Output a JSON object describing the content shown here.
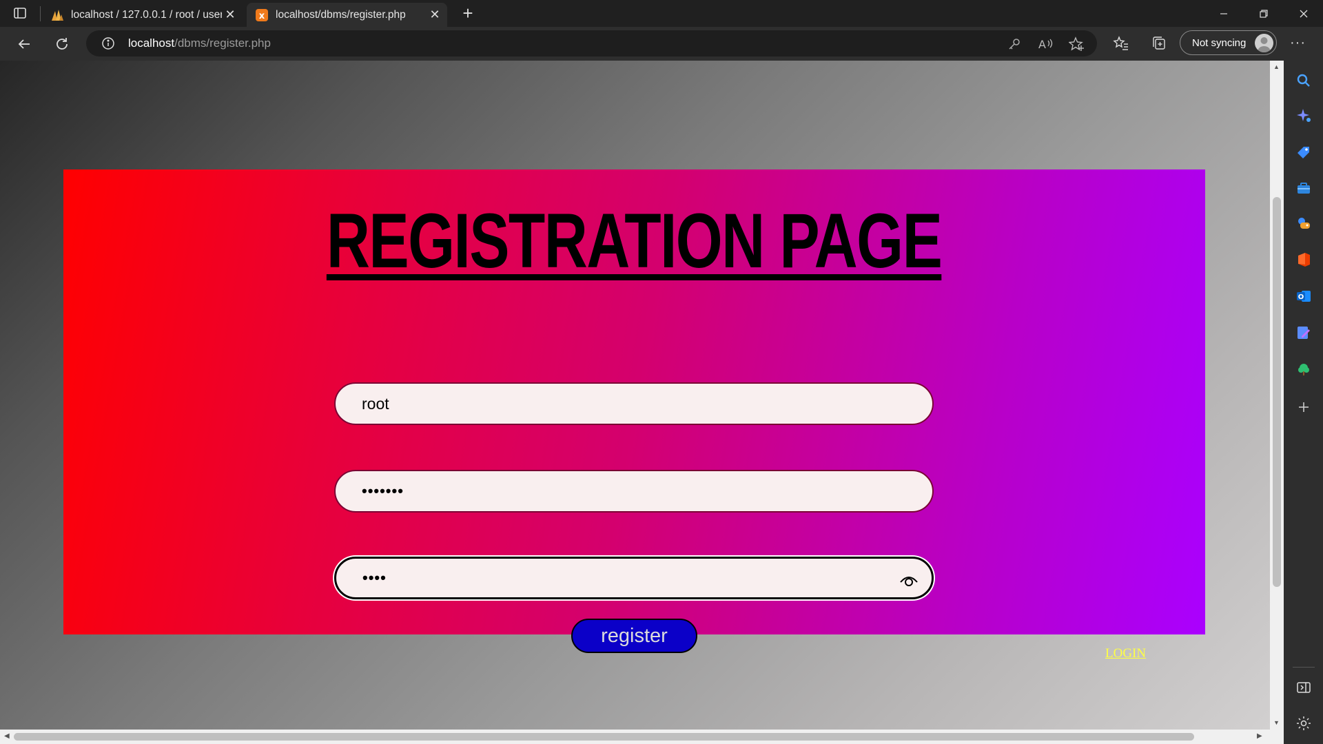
{
  "browser": {
    "tabs": [
      {
        "title": "localhost / 127.0.0.1 / root / user",
        "favicon": "phpmyadmin-icon",
        "active": false
      },
      {
        "title": "localhost/dbms/register.php",
        "favicon": "xampp-icon",
        "active": true
      }
    ],
    "address": {
      "host": "localhost",
      "path": "/dbms/register.php"
    },
    "profile_label": "Not syncing",
    "more_label": "···"
  },
  "page": {
    "heading": "REGISTRATION PAGE",
    "username_value": "root",
    "password_mask": "•••••••",
    "confirm_mask": "••••",
    "register_label": "register",
    "login_label": "LOGIN"
  },
  "colors": {
    "card_gradient_start": "#ff0000",
    "card_gradient_end": "#aa00ff",
    "register_button": "#0b00c8",
    "login_link": "#ffff44",
    "input_bg": "#f9efef"
  },
  "sidebar_icons": [
    "search-icon",
    "copilot-icon",
    "shopping-tag-icon",
    "tools-icon",
    "games-icon",
    "office-icon",
    "outlook-icon",
    "drop-icon",
    "tree-icon",
    "add-icon",
    "split-screen-icon",
    "settings-icon"
  ]
}
